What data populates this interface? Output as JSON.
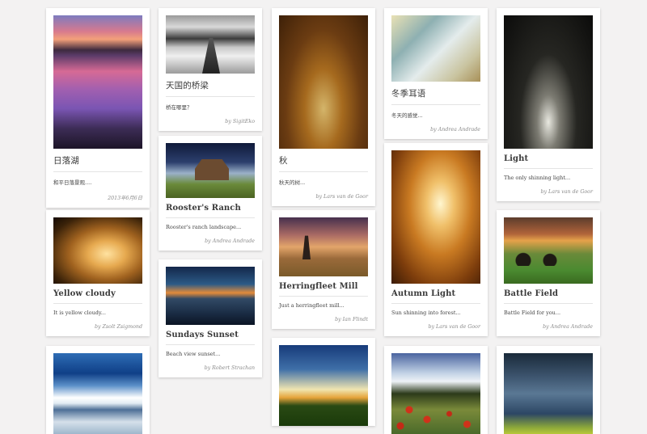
{
  "cards": [
    {
      "title": "日落湖",
      "description": "和平日落景观....",
      "meta": "2013年6月6日",
      "image": "sunset-lake-photo"
    },
    {
      "title": "天国的桥梁",
      "description": "桥在哪里？",
      "meta": "by SigitEko",
      "image": "pier-photo"
    },
    {
      "title": "秋",
      "description": "秋天的树...",
      "meta": "by Lars van de Goor",
      "image": "autumn-forest-photo"
    },
    {
      "title": "冬季耳语",
      "description": "冬天的感觉...",
      "meta": "by Andrea Andrade",
      "image": "winter-tree-photo"
    },
    {
      "title": "Light",
      "description": "The only shinning light...",
      "meta": "by Lars van de Goor",
      "image": "dark-forest-light-photo"
    },
    {
      "title": "Rooster's Ranch",
      "description": "Rooster's ranch landscape...",
      "meta": "by Andrea Andrade",
      "image": "ranch-photo"
    },
    {
      "title": "Sundays Sunset",
      "description": "Beach view sunset...",
      "meta": "by Robert Strachan",
      "image": "beach-sunset-photo"
    },
    {
      "title": "Herringfleet Mill",
      "description": "Just a herringfleet mill...",
      "meta": "by Ian Flindt",
      "image": "windmill-photo"
    },
    {
      "title": "Autumn Light",
      "description": "Sun shinning into forest...",
      "meta": "by Lars van de Goor",
      "image": "autumn-light-photo"
    },
    {
      "title": "Battle Field",
      "description": "Battle Field for you...",
      "meta": "by Andrea Andrade",
      "image": "battlefield-photo"
    },
    {
      "title": "Yellow cloudy",
      "description": "It is yellow cloudy...",
      "meta": "by Zsolt Zsigmond",
      "image": "yellow-cloudy-photo"
    },
    {
      "image": "blue-beach-photo"
    },
    {
      "image": "sunflower-photo"
    },
    {
      "image": "poppy-field-photo"
    },
    {
      "image": "storm-sky-photo"
    }
  ]
}
